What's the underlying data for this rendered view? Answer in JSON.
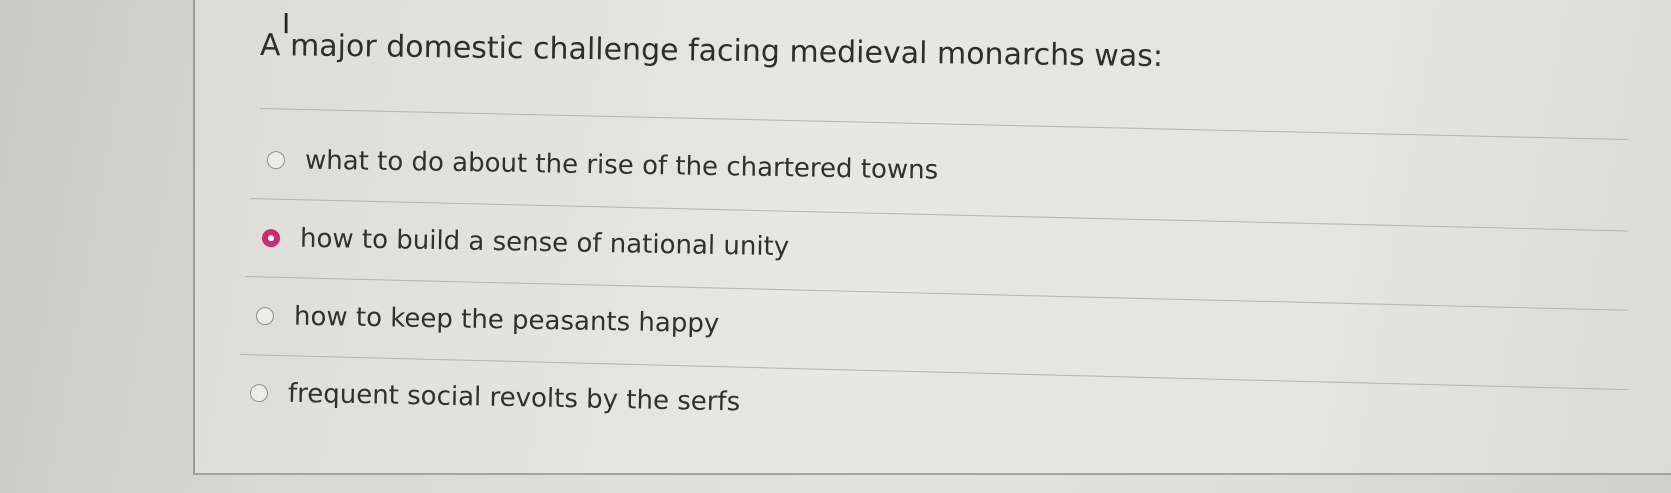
{
  "quiz": {
    "question": "A major domestic challenge facing medieval monarchs was:",
    "selected_index": 1,
    "options": [
      {
        "label": "what to do about the rise of the chartered towns",
        "selected": false
      },
      {
        "label": "how to build a sense of national unity",
        "selected": true
      },
      {
        "label": "how to keep the peasants happy",
        "selected": false
      },
      {
        "label": "frequent social revolts by the serfs",
        "selected": false
      }
    ]
  },
  "colors": {
    "accent": "#c72e6c",
    "text": "#303030"
  },
  "icons": {
    "cursor": "text-cursor-ibeam-icon"
  }
}
